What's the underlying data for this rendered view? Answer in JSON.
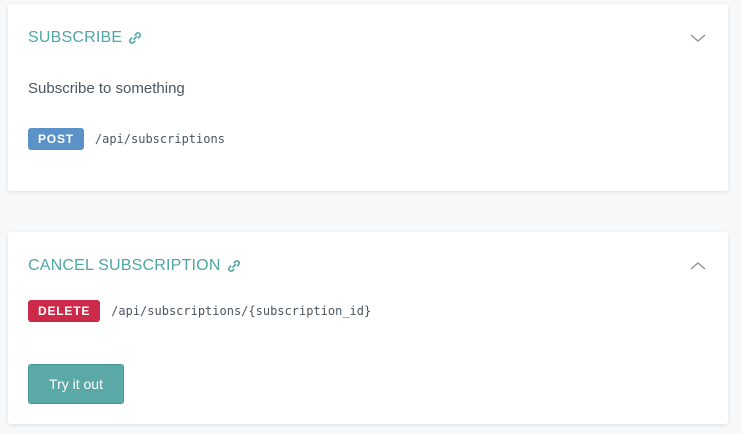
{
  "colors": {
    "title": "#4ea6a5",
    "post_badge": "#5b93c9",
    "delete_badge": "#cc2a48",
    "button": "#5aa9a6",
    "text": "#4a5562"
  },
  "subscribe": {
    "title": "SUBSCRIBE",
    "link_icon": "link-icon",
    "toggle_icon": "chevron-down-icon",
    "description": "Subscribe to something",
    "method": "POST",
    "path": "/api/subscriptions"
  },
  "cancel": {
    "title": "CANCEL SUBSCRIPTION",
    "link_icon": "link-icon",
    "toggle_icon": "chevron-up-icon",
    "method": "DELETE",
    "path": "/api/subscriptions/{subscription_id}",
    "button_label": "Try it out"
  }
}
